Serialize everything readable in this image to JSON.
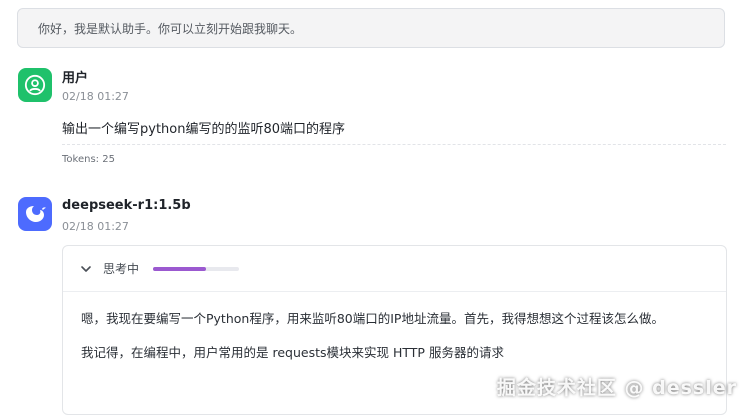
{
  "system_banner": {
    "text": "你好，我是默认助手。你可以立刻开始跟我聊天。"
  },
  "user_message": {
    "name": "用户",
    "timestamp": "02/18 01:27",
    "content": "输出一个编写python编写的的监听80端口的程序",
    "tokens": "Tokens: 25",
    "avatar_icon": "user-icon",
    "avatar_color": "#1fc16b"
  },
  "assistant_message": {
    "name": "deepseek-r1:1.5b",
    "timestamp": "02/18 01:27",
    "avatar_icon": "deepseek-whale-icon",
    "avatar_color": "#4d6bfe",
    "thinking": {
      "label": "思考中",
      "progress": 0.62,
      "progress_color": "#9b59d0",
      "paragraphs": [
        "嗯，我现在要编写一个Python程序，用来监听80端口的IP地址流量。首先，我得想想这个过程该怎么做。",
        "我记得，在编程中，用户常用的是 requests模块来实现 HTTP 服务器的请求"
      ]
    }
  },
  "watermark": {
    "text": "掘金技术社区 @ dessler"
  }
}
